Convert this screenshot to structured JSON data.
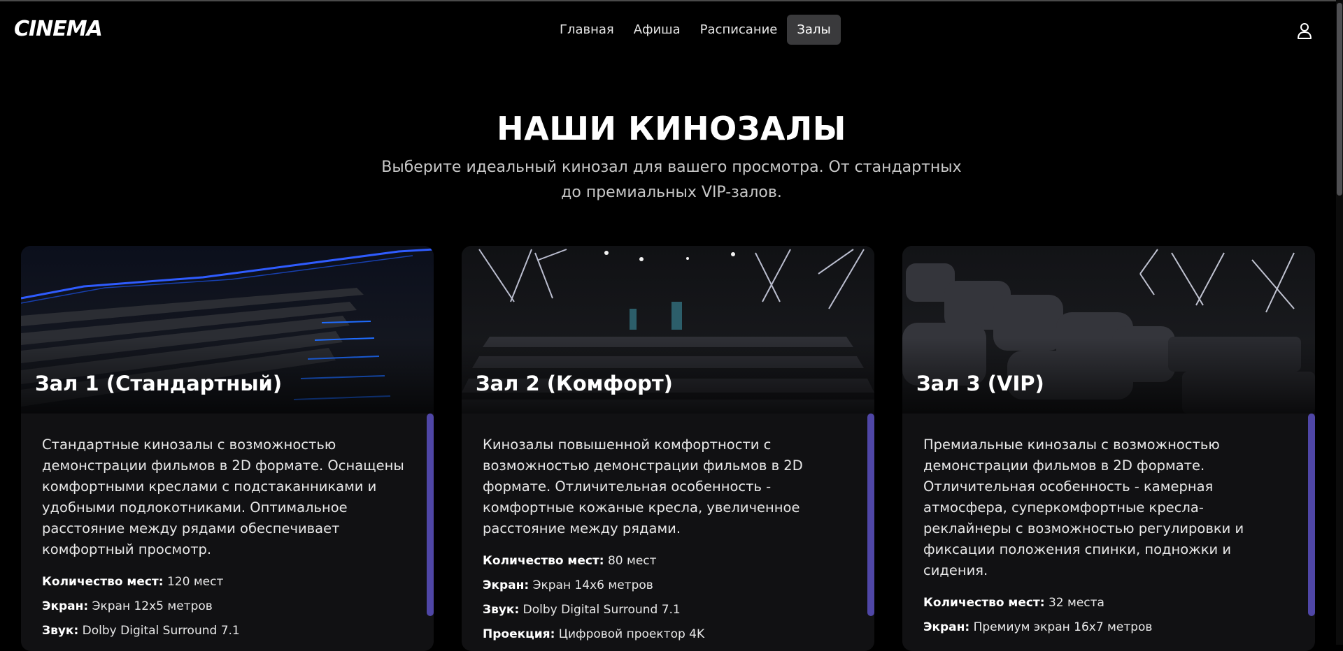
{
  "header": {
    "logo": "CINEMA",
    "nav": [
      {
        "label": "Главная",
        "active": false
      },
      {
        "label": "Афиша",
        "active": false
      },
      {
        "label": "Расписание",
        "active": false
      },
      {
        "label": "Залы",
        "active": true
      }
    ],
    "user_icon": "user-icon"
  },
  "hero": {
    "title": "НАШИ КИНОЗАЛЫ",
    "subtitle": "Выберите идеальный кинозал для вашего просмотра. От стандартных до премиальных VIP-залов."
  },
  "halls": [
    {
      "name": "Зал 1 (Стандартный)",
      "description": "Стандартные кинозалы с возможностью демонстрации фильмов в 2D формате. Оснащены комфортными креслами с подстаканниками и удобными подлокотниками. Оптимальное расстояние между рядами обеспечивает комфортный просмотр.",
      "specs": [
        {
          "label": "Количество мест:",
          "value": "120 мест"
        },
        {
          "label": "Экран:",
          "value": "Экран 12x5 метров"
        },
        {
          "label": "Звук:",
          "value": "Dolby Digital Surround 7.1"
        }
      ]
    },
    {
      "name": "Зал 2 (Комфорт)",
      "description": "Кинозалы повышенной комфортности с возможностью демонстрации фильмов в 2D формате. Отличительная особенность - комфортные кожаные кресла, увеличенное расстояние между рядами.",
      "specs": [
        {
          "label": "Количество мест:",
          "value": "80 мест"
        },
        {
          "label": "Экран:",
          "value": "Экран 14x6 метров"
        },
        {
          "label": "Звук:",
          "value": "Dolby Digital Surround 7.1"
        },
        {
          "label": "Проекция:",
          "value": "Цифровой проектор 4K"
        }
      ]
    },
    {
      "name": "Зал 3 (VIP)",
      "description": "Премиальные кинозалы с возможностью демонстрации фильмов в 2D формате. Отличительная особенность - камерная атмосфера, суперкомфортные кресла-реклайнеры с возможностью регулировки и фиксации положения спинки, подножки и сидения.",
      "specs": [
        {
          "label": "Количество мест:",
          "value": "32 места"
        },
        {
          "label": "Экран:",
          "value": "Премиум экран 16x7 метров"
        }
      ]
    }
  ],
  "colors": {
    "background": "#000000",
    "card": "#111113",
    "accent_scrollbar": "#4f46a6",
    "nav_active": "#3a3a3c"
  }
}
